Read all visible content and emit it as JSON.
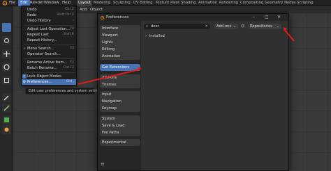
{
  "app": {
    "menus": [
      "File",
      "Edit",
      "Render",
      "Window",
      "Help"
    ],
    "workspace_tabs": [
      "Layout",
      "Modeling",
      "Sculpting",
      "UV Editing",
      "Texture Paint",
      "Shading",
      "Animation",
      "Rendering",
      "Compositing",
      "Geometry Nodes",
      "Scripting"
    ],
    "active_tab": "Layout"
  },
  "viewport_header": {
    "items": [
      "Add",
      "Object"
    ]
  },
  "edit_menu": {
    "items": [
      {
        "label": "Undo",
        "shortcut": "Ctrl Z",
        "icon": ""
      },
      {
        "label": "Redo",
        "shortcut": "Shift Ctrl Z",
        "icon": ""
      },
      {
        "label": "Undo History",
        "shortcut": "",
        "icon": ""
      },
      {
        "label": "Adjust Last Operation...",
        "shortcut": "F9",
        "icon": ""
      },
      {
        "label": "Repeat Last",
        "shortcut": "Shift R",
        "icon": ""
      },
      {
        "label": "Repeat History...",
        "shortcut": "",
        "icon": ""
      },
      {
        "label": "Menu Search...",
        "shortcut": "F3",
        "icon": "search-icon"
      },
      {
        "label": "Operator Search...",
        "shortcut": "",
        "icon": ""
      },
      {
        "label": "Rename Active Item...",
        "shortcut": "F2",
        "icon": ""
      },
      {
        "label": "Batch Rename...",
        "shortcut": "Ctrl F2",
        "icon": ""
      },
      {
        "label": "Lock Object Modes",
        "shortcut": "",
        "icon": "checkbox-icon"
      },
      {
        "label": "Preferences...",
        "shortcut": "Ctrl ,",
        "icon": "gear-icon"
      }
    ],
    "highlighted": "Preferences..."
  },
  "tooltip": {
    "text": "Edit user preferences and system settings."
  },
  "preferences": {
    "title": "Preferences",
    "nav_groups": [
      [
        "Interface",
        "Viewport",
        "Lights",
        "Editing",
        "Animation"
      ],
      [
        "Get Extensions"
      ],
      [
        "Add-ons",
        "Themes"
      ],
      [
        "Input",
        "Navigation",
        "Keymap"
      ],
      [
        "System",
        "Save & Load",
        "File Paths"
      ],
      [
        "Experimental"
      ]
    ],
    "selected": "Get Extensions",
    "search": {
      "value": "deer"
    },
    "filter_dropdown": "Add-ons",
    "repositories_dropdown": "Repositories",
    "installed_label": "Installed"
  },
  "colors": {
    "accent": "#4772b3",
    "annotation": "#e21b1b"
  },
  "icons": [
    "blender-logo-icon",
    "search-icon",
    "gear-icon",
    "close-icon",
    "minimize-icon",
    "maximize-icon",
    "chevron-down-icon",
    "chevron-right-icon",
    "tag-icon",
    "hamburger-icon"
  ]
}
